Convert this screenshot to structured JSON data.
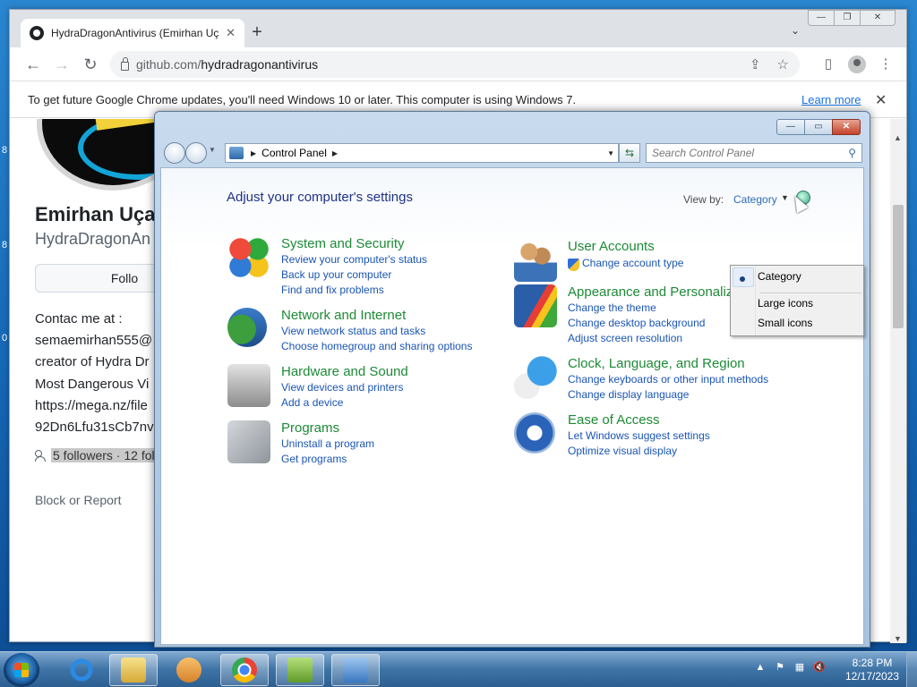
{
  "chrome": {
    "tab_title": "HydraDragonAntivirus (Emirhan Uçan)",
    "new_tab": "+",
    "url_host": "github.com/",
    "url_path": "hydradragonantivirus",
    "infobar_text": "To get future Google Chrome updates, you'll need Windows 10 or later. This computer is using Windows 7.",
    "infobar_learn_more": "Learn more"
  },
  "github": {
    "name": "Emirhan Uça",
    "login": "HydraDragonAn",
    "follow_label": "Follo",
    "bio_lines": [
      "Contac me at :",
      "semaemirhan555@",
      "creator of Hydra Dr",
      "Most Dangerous Vi",
      "https://mega.nz/file",
      "92Dn6Lfu31sCb7nv"
    ],
    "followers_text": "5 followers · 12 fol",
    "block_report": "Block or Report"
  },
  "control_panel": {
    "breadcrumb": "Control Panel",
    "search_placeholder": "Search Control Panel",
    "heading": "Adjust your computer's settings",
    "view_by_label": "View by:",
    "view_by_value": "Category",
    "view_options": [
      "Category",
      "Large icons",
      "Small icons"
    ],
    "categories": [
      {
        "title": "System and Security",
        "links": [
          "Review your computer's status",
          "Back up your computer",
          "Find and fix problems"
        ]
      },
      {
        "title": "Network and Internet",
        "links": [
          "View network status and tasks",
          "Choose homegroup and sharing options"
        ]
      },
      {
        "title": "Hardware and Sound",
        "links": [
          "View devices and printers",
          "Add a device"
        ]
      },
      {
        "title": "Programs",
        "links": [
          "Uninstall a program",
          "Get programs"
        ]
      },
      {
        "title": "User Accounts",
        "links": [
          "Change account type"
        ]
      },
      {
        "title": "Appearance and Personalization",
        "links": [
          "Change the theme",
          "Change desktop background",
          "Adjust screen resolution"
        ]
      },
      {
        "title": "Clock, Language, and Region",
        "links": [
          "Change keyboards or other input methods",
          "Change display language"
        ]
      },
      {
        "title": "Ease of Access",
        "links": [
          "Let Windows suggest settings",
          "Optimize visual display"
        ]
      }
    ]
  },
  "taskbar": {
    "time": "8:28 PM",
    "date": "12/17/2023"
  },
  "desktop_marks": [
    "8",
    "8",
    "0"
  ]
}
